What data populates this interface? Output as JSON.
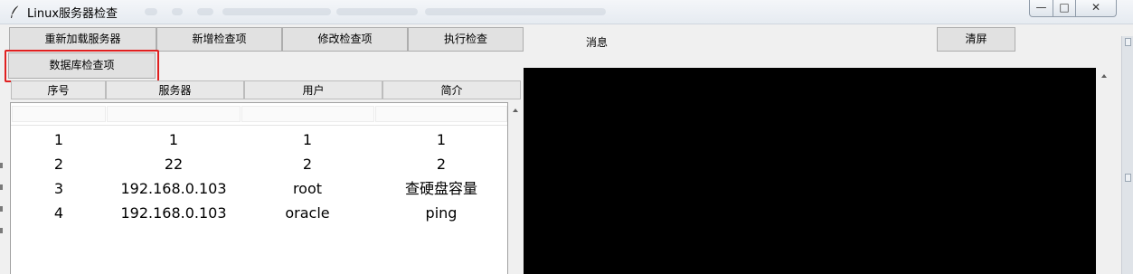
{
  "window": {
    "title": "Linux服务器检查",
    "controls": {
      "minimize": "—",
      "maximize": "□",
      "close": "✕"
    }
  },
  "toolbar": {
    "reload_servers": "重新加载服务器",
    "add_check": "新增检查项",
    "edit_check": "修改检查项",
    "run_check": "执行检查",
    "clear_screen": "清屏",
    "db_check": "数据库检查项"
  },
  "messages": {
    "label": "消息"
  },
  "table": {
    "columns": [
      "序号",
      "服务器",
      "用户",
      "简介"
    ],
    "rows": [
      [
        "1",
        "1",
        "1",
        "1"
      ],
      [
        "2",
        "22",
        "2",
        "2"
      ],
      [
        "3",
        "192.168.0.103",
        "root",
        "查硬盘容量"
      ],
      [
        "4",
        "192.168.0.103",
        "oracle",
        "ping"
      ]
    ]
  },
  "colors": {
    "highlight": "#e02020",
    "console_bg": "#000000",
    "window_bg": "#f0f0f0"
  },
  "icons": {
    "app": "feather-icon"
  }
}
